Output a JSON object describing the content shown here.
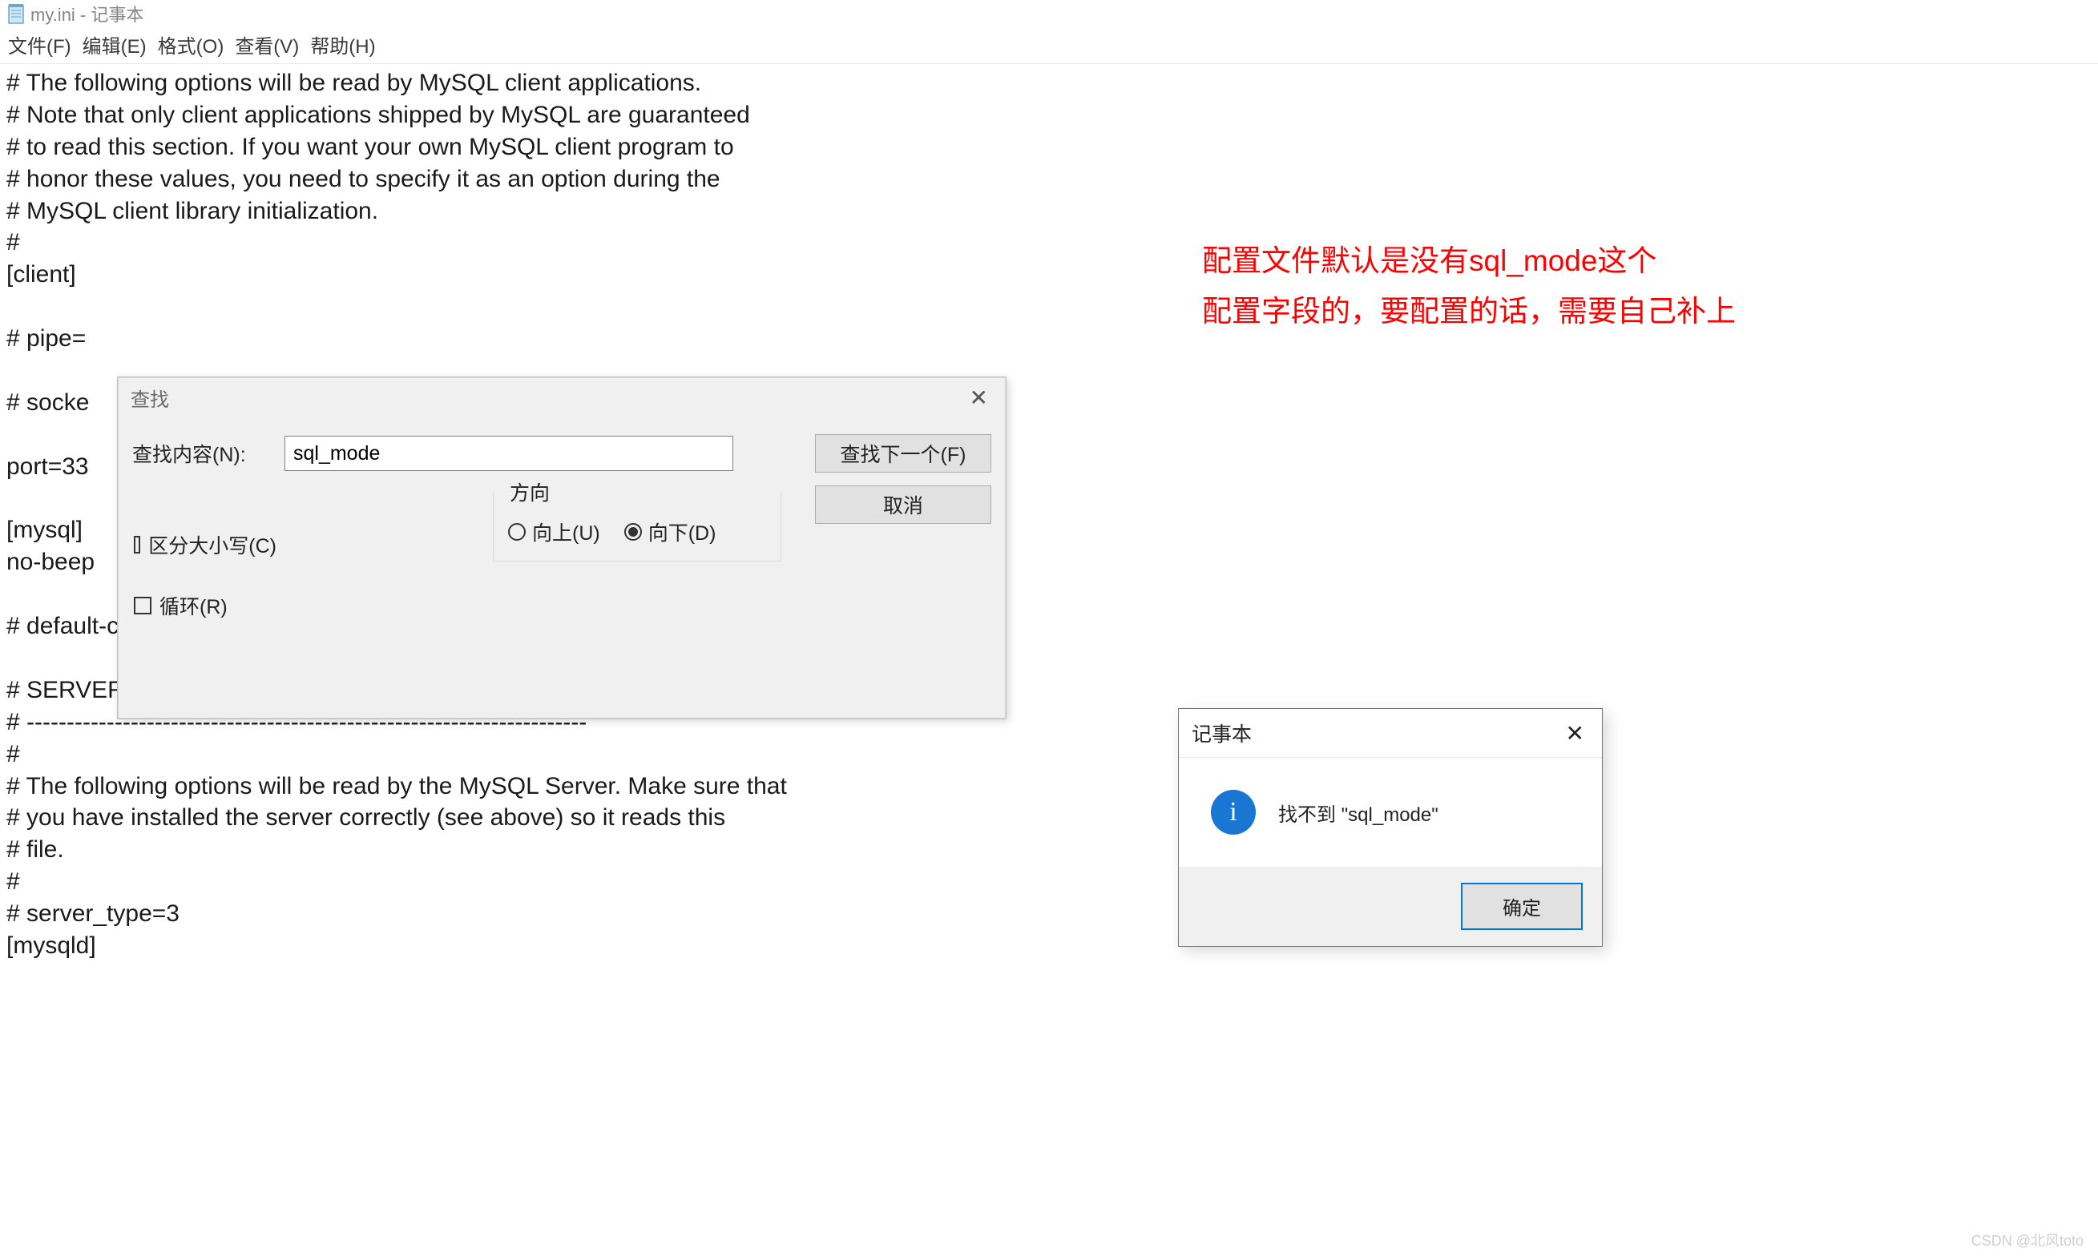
{
  "window": {
    "title": "my.ini - 记事本"
  },
  "menu": {
    "file": "文件(F)",
    "edit": "编辑(E)",
    "format": "格式(O)",
    "view": "查看(V)",
    "help": "帮助(H)"
  },
  "content": "# The following options will be read by MySQL client applications.\n# Note that only client applications shipped by MySQL are guaranteed\n# to read this section. If you want your own MySQL client program to\n# honor these values, you need to specify it as an option during the\n# MySQL client library initialization.\n#\n[client]\n\n# pipe=\n\n# socke\n\nport=33\n\n[mysql]\nno-beep\n\n# default-character-set=\n\n# SERVER SECTION\n# ----------------------------------------------------------------------\n#\n# The following options will be read by the MySQL Server. Make sure that\n# you have installed the server correctly (see above) so it reads this\n# file.\n#\n# server_type=3\n[mysqld]",
  "annotation": {
    "line1": "配置文件默认是没有sql_mode这个",
    "line2": "配置字段的，要配置的话，需要自己补上"
  },
  "find": {
    "title": "查找",
    "label": "查找内容(N):",
    "value": "sql_mode",
    "find_next": "查找下一个(F)",
    "cancel": "取消",
    "direction_label": "方向",
    "up": "向上(U)",
    "down": "向下(D)",
    "match_case": "区分大小写(C)",
    "wrap": "循环(R)",
    "selected_direction": "down"
  },
  "msg": {
    "title": "记事本",
    "text": "找不到 \"sql_mode\"",
    "ok": "确定"
  },
  "watermark": "CSDN @北风toto"
}
